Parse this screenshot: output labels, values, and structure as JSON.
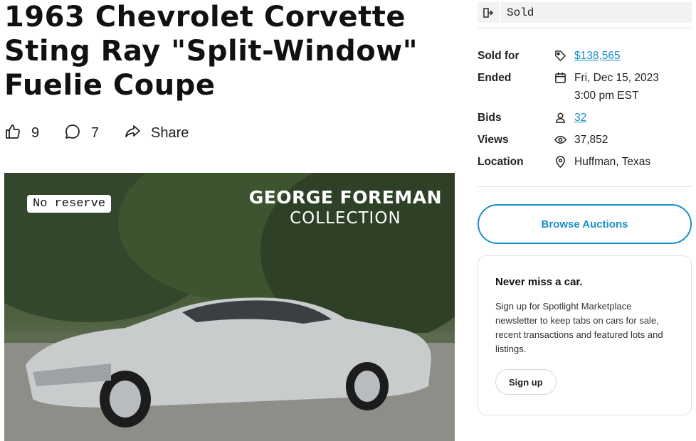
{
  "listing": {
    "title_lines": [
      "1963 Chevrolet Corvette",
      "Sting Ray \"Split-Window\"",
      "Fuelie Coupe"
    ],
    "likes": "9",
    "comments": "7",
    "share_label": "Share",
    "badge": "No reserve",
    "collection_line1": "GEORGE FOREMAN",
    "collection_line2": "COLLECTION"
  },
  "sidebar": {
    "status": "Sold",
    "facts": [
      {
        "key": "Sold for",
        "icon": "tag-icon",
        "value": "$138,565",
        "link": true
      },
      {
        "key": "Ended",
        "icon": "calendar-icon",
        "value": "Fri, Dec 15, 2023",
        "value2": "3:00 pm EST",
        "link": false
      },
      {
        "key": "Bids",
        "icon": "person-icon",
        "value": "32",
        "link": true
      },
      {
        "key": "Views",
        "icon": "eye-icon",
        "value": "37,852",
        "link": false
      },
      {
        "key": "Location",
        "icon": "pin-icon",
        "value": "Huffman, Texas",
        "link": false
      }
    ],
    "browse_label": "Browse Auctions",
    "newsletter": {
      "heading": "Never miss a car.",
      "body": "Sign up for Spotlight Marketplace newsletter to keep tabs on cars for sale, recent transactions and featured lots and listings.",
      "button": "Sign up"
    }
  },
  "colors": {
    "accent": "#1a8fc7",
    "status_bg": "#f1f2f3"
  }
}
